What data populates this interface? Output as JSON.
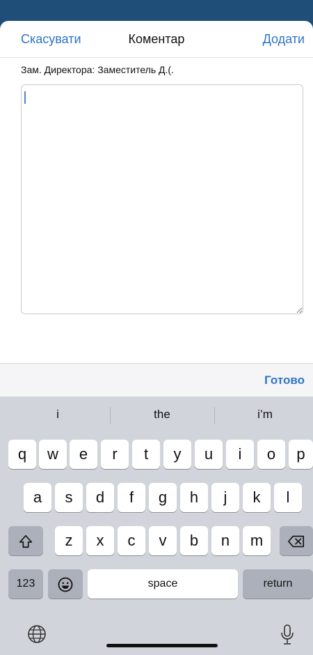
{
  "nav": {
    "cancel_label": "Скасувати",
    "title": "Коментар",
    "add_label": "Додати"
  },
  "recipient": "Зам. Директора: Заместитель Д.(.",
  "comment": {
    "value": ""
  },
  "toolbar": {
    "done_label": "Готово"
  },
  "keyboard": {
    "suggestions": [
      "i",
      "the",
      "i’m"
    ],
    "row1": [
      "q",
      "w",
      "e",
      "r",
      "t",
      "y",
      "u",
      "i",
      "o",
      "p"
    ],
    "row2": [
      "a",
      "s",
      "d",
      "f",
      "g",
      "h",
      "j",
      "k",
      "l"
    ],
    "row3": [
      "z",
      "x",
      "c",
      "v",
      "b",
      "n",
      "m"
    ],
    "numbers_label": "123",
    "space_label": "space",
    "return_label": "return",
    "icons": {
      "shift": "shift-icon",
      "delete": "delete-icon",
      "emoji": "emoji-icon",
      "globe": "globe-icon",
      "mic": "mic-icon"
    }
  },
  "colors": {
    "accent": "#2f73c7",
    "header_band": "#1f4f79",
    "keyboard_bg": "#d1d4db"
  }
}
